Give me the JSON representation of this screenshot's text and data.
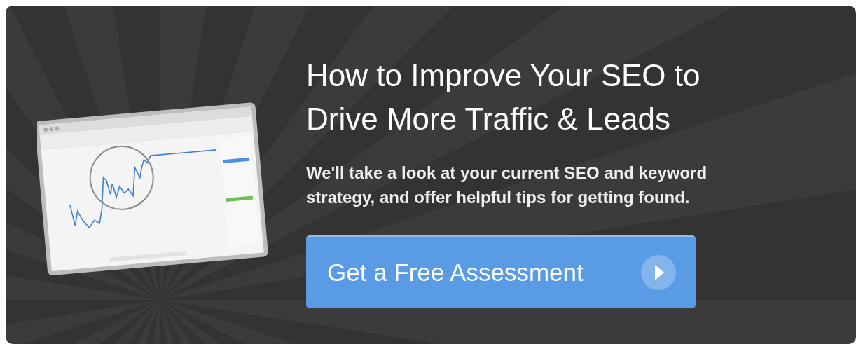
{
  "banner": {
    "title": "How to Improve Your SEO to Drive More Traffic & Leads",
    "description": "We'll take a look at your current SEO and keyword strategy, and offer helpful tips for getting found.",
    "button": {
      "label": "Get a Free Assessment"
    }
  }
}
